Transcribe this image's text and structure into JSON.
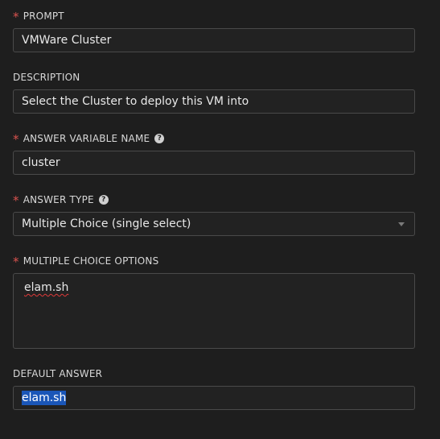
{
  "prompt": {
    "label": "PROMPT",
    "value": "VMWare Cluster"
  },
  "description": {
    "label": "DESCRIPTION",
    "value": "Select the Cluster to deploy this VM into"
  },
  "variable_name": {
    "label": "ANSWER VARIABLE NAME",
    "value": "cluster",
    "help_icon": "question-circle-icon"
  },
  "answer_type": {
    "label": "ANSWER TYPE",
    "value": "Multiple Choice (single select)",
    "help_icon": "question-circle-icon"
  },
  "choices": {
    "label": "MULTIPLE CHOICE OPTIONS",
    "value": "elam.sh"
  },
  "default_answer": {
    "label": "DEFAULT ANSWER",
    "value": "elam.sh"
  },
  "required_marker": "*",
  "colors": {
    "background": "#1e1e1e",
    "required": "#d9534f",
    "selection": "#1a56b8",
    "border": "#4a4a4a"
  }
}
